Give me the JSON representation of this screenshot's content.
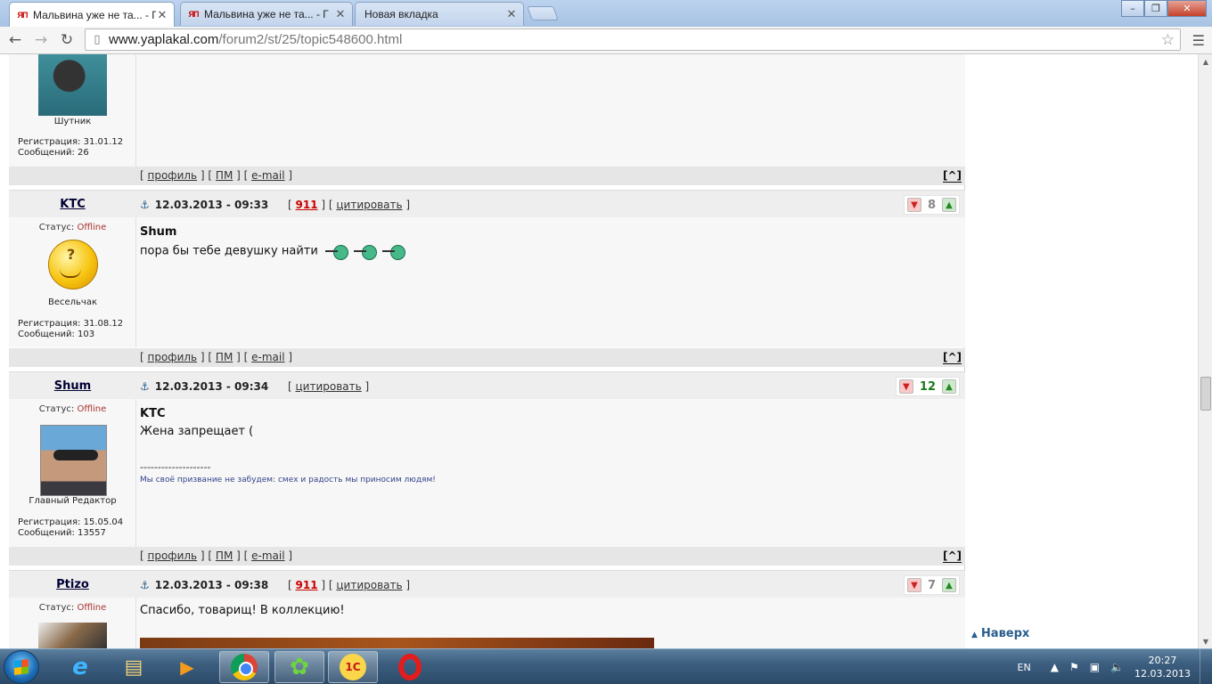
{
  "browser": {
    "tabs": [
      {
        "favicon": "ЯП",
        "title": "Мальвина уже не та... - Г",
        "active": true
      },
      {
        "favicon": "ЯП",
        "title": "Мальвина уже не та... - Г",
        "active": false
      },
      {
        "favicon": "",
        "title": "Новая вкладка",
        "active": false
      }
    ],
    "url_domain": "www.yaplakal.com",
    "url_path": "/forum2/st/25/topic548600.html"
  },
  "posts": [
    {
      "id": "p0",
      "rank": "Шутник",
      "registration": "Регистрация: 31.01.12",
      "messages": "Сообщений: 26",
      "footer": {
        "profile": "профиль",
        "pm": "ПМ",
        "email": "e-mail",
        "totop": "[^]"
      }
    },
    {
      "id": "p1",
      "author": "KTC",
      "date": "12.03.2013 - 09:33",
      "num": "911",
      "quote": "цитировать",
      "rating": "8",
      "status_label": "Статус:",
      "status_value": "Offline",
      "rank": "Весельчак",
      "registration": "Регистрация: 31.08.12",
      "messages": "Сообщений: 103",
      "quote_to": "Shum",
      "text": "пора бы тебе девушку найти",
      "footer": {
        "profile": "профиль",
        "pm": "ПМ",
        "email": "e-mail",
        "totop": "[^]"
      }
    },
    {
      "id": "p2",
      "author": "Shum",
      "date": "12.03.2013 - 09:34",
      "quote": "цитировать",
      "rating": "12",
      "status_label": "Статус:",
      "status_value": "Offline",
      "rank": "Главный Редактор",
      "registration": "Регистрация: 15.05.04",
      "messages": "Сообщений: 13557",
      "quote_to": "KTC",
      "text": "Жена запрещает (",
      "sig_line": "--------------------",
      "signature": "Мы своё призвание не забудем: смех и радость мы приносим людям!",
      "footer": {
        "profile": "профиль",
        "pm": "ПМ",
        "email": "e-mail",
        "totop": "[^]"
      }
    },
    {
      "id": "p3",
      "author": "Ptizo",
      "date": "12.03.2013 - 09:38",
      "num": "911",
      "quote": "цитировать",
      "rating": "7",
      "status_label": "Статус:",
      "status_value": "Offline",
      "text": "Спасибо, товарищ! В коллекцию!"
    }
  ],
  "sidebar": {
    "to_top": "Наверх"
  },
  "taskbar": {
    "lang": "EN",
    "time": "20:27",
    "date": "12.03.2013",
    "apps": [
      "ie-icon",
      "explorer-icon",
      "media-player-icon",
      "chrome-icon",
      "icq-icon",
      "1c-icon",
      "opera-icon"
    ]
  },
  "colors": {
    "link_red": "#cc0000",
    "accent_blue": "#2a5d8c",
    "offline": "#aa3333",
    "positive": "#1a7a1a"
  }
}
